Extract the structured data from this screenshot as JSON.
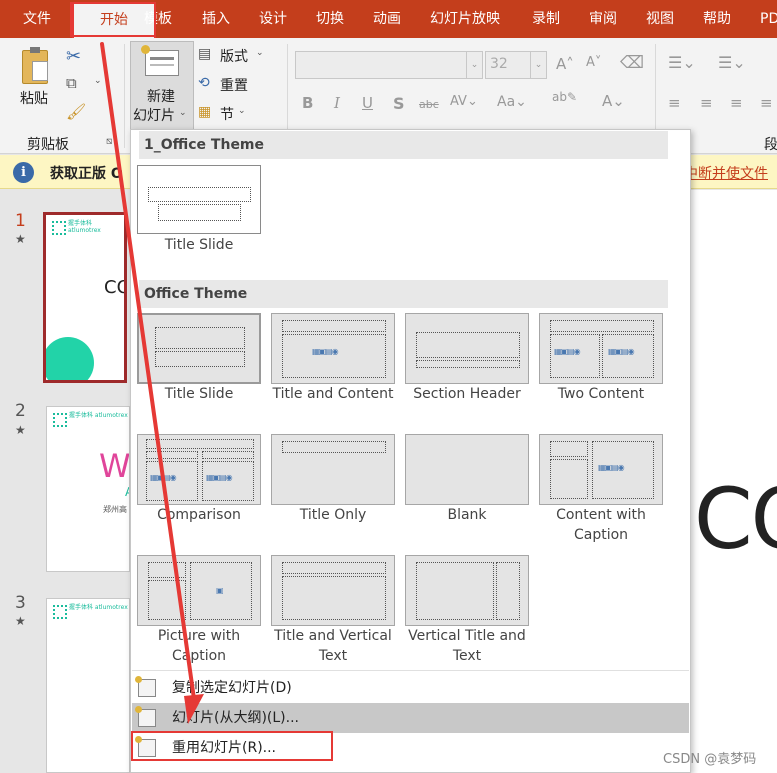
{
  "menubar": {
    "tabs": [
      {
        "label": "文件"
      },
      {
        "label": "开始"
      },
      {
        "label": "模板"
      },
      {
        "label": "插入"
      },
      {
        "label": "设计"
      },
      {
        "label": "切换"
      },
      {
        "label": "动画"
      },
      {
        "label": "幻灯片放映"
      },
      {
        "label": "录制"
      },
      {
        "label": "审阅"
      },
      {
        "label": "视图"
      },
      {
        "label": "帮助"
      },
      {
        "label": "PD"
      }
    ]
  },
  "ribbon": {
    "paste_label": "粘贴",
    "clipboard_label": "剪贴板",
    "new_slide_label_line1": "新建",
    "new_slide_label_line2": "幻灯片",
    "layout_label": "版式",
    "reset_label": "重置",
    "section_label": "节",
    "font_size_value": "32",
    "truncated_group_label": "段"
  },
  "infobar": {
    "title": "获取正版 O",
    "trailing_text": "中断并使文件"
  },
  "slides_panel": {
    "slides": [
      {
        "number": "1",
        "brand_text": "握手体科 atlumotrex",
        "center_text": "CO"
      },
      {
        "number": "2",
        "brand_text": "握手体科 atlumotrex",
        "center_text": "W",
        "sub_text": "A",
        "tag_text": "郑州高"
      },
      {
        "number": "3",
        "brand_text": "握手体科 atlumotrex"
      }
    ]
  },
  "canvas": {
    "big_text": "CO"
  },
  "dropdown": {
    "section1_title": "1_Office Theme",
    "section1_layouts": [
      {
        "caption": "Title Slide"
      }
    ],
    "section2_title": "Office Theme",
    "section2_layouts": [
      {
        "caption": "Title Slide"
      },
      {
        "caption": "Title and Content"
      },
      {
        "caption": "Section Header"
      },
      {
        "caption": "Two Content"
      },
      {
        "caption": "Comparison"
      },
      {
        "caption": "Title Only"
      },
      {
        "caption": "Blank"
      },
      {
        "caption": "Content with Caption"
      },
      {
        "caption": "Picture with Caption"
      },
      {
        "caption": "Title and Vertical Text"
      },
      {
        "caption": "Vertical Title and Text"
      }
    ],
    "menu_items": [
      {
        "label": "复制选定幻灯片(D)"
      },
      {
        "label": "幻灯片(从大纲)(L)..."
      },
      {
        "label": "重用幻灯片(R)..."
      }
    ]
  },
  "watermark": "CSDN @袁梦码",
  "colors": {
    "accent": "#c43e1c",
    "annotation": "#e53935",
    "selection_border": "#9e2a2b"
  }
}
